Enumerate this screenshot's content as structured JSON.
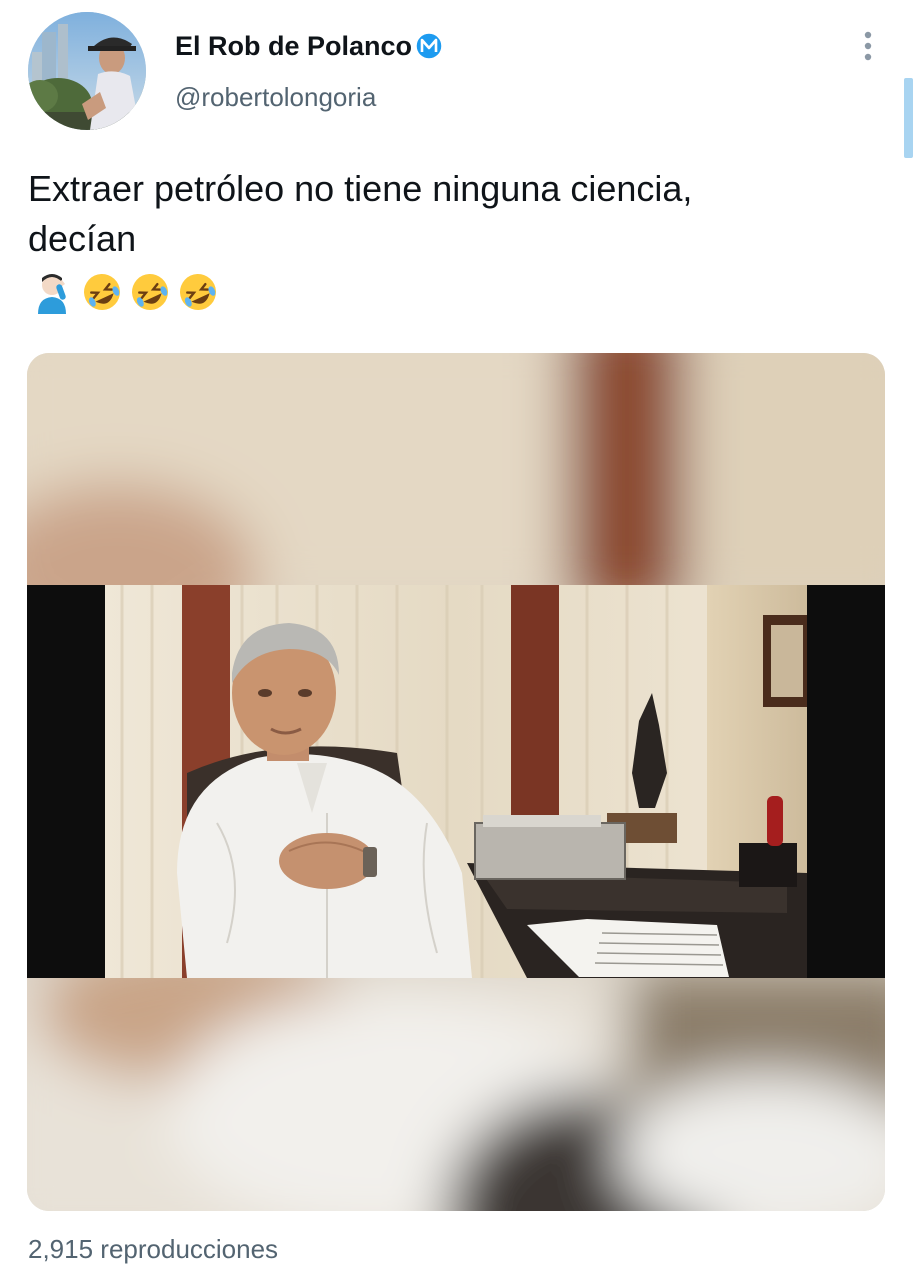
{
  "tweet": {
    "author": {
      "display_name": "El Rob de Polanco",
      "handle": "@robertolongoria",
      "badge_icon": "m-badge-icon",
      "badge_color": "#1d9bf0"
    },
    "text_line1": "Extraer petróleo no tiene ninguna ciencia,",
    "text_line2": "decían",
    "emojis": [
      "facepalm-emoji",
      "rolling-laughing-emoji",
      "rolling-laughing-emoji",
      "rolling-laughing-emoji"
    ],
    "media": {
      "type": "video",
      "thumbnail_description_icon": "video-thumbnail"
    },
    "views_text": "2,915 reproducciones"
  },
  "ui": {
    "more_icon": "more-vertical-icon",
    "text_color": "#0f1419",
    "secondary_color": "#536471"
  }
}
